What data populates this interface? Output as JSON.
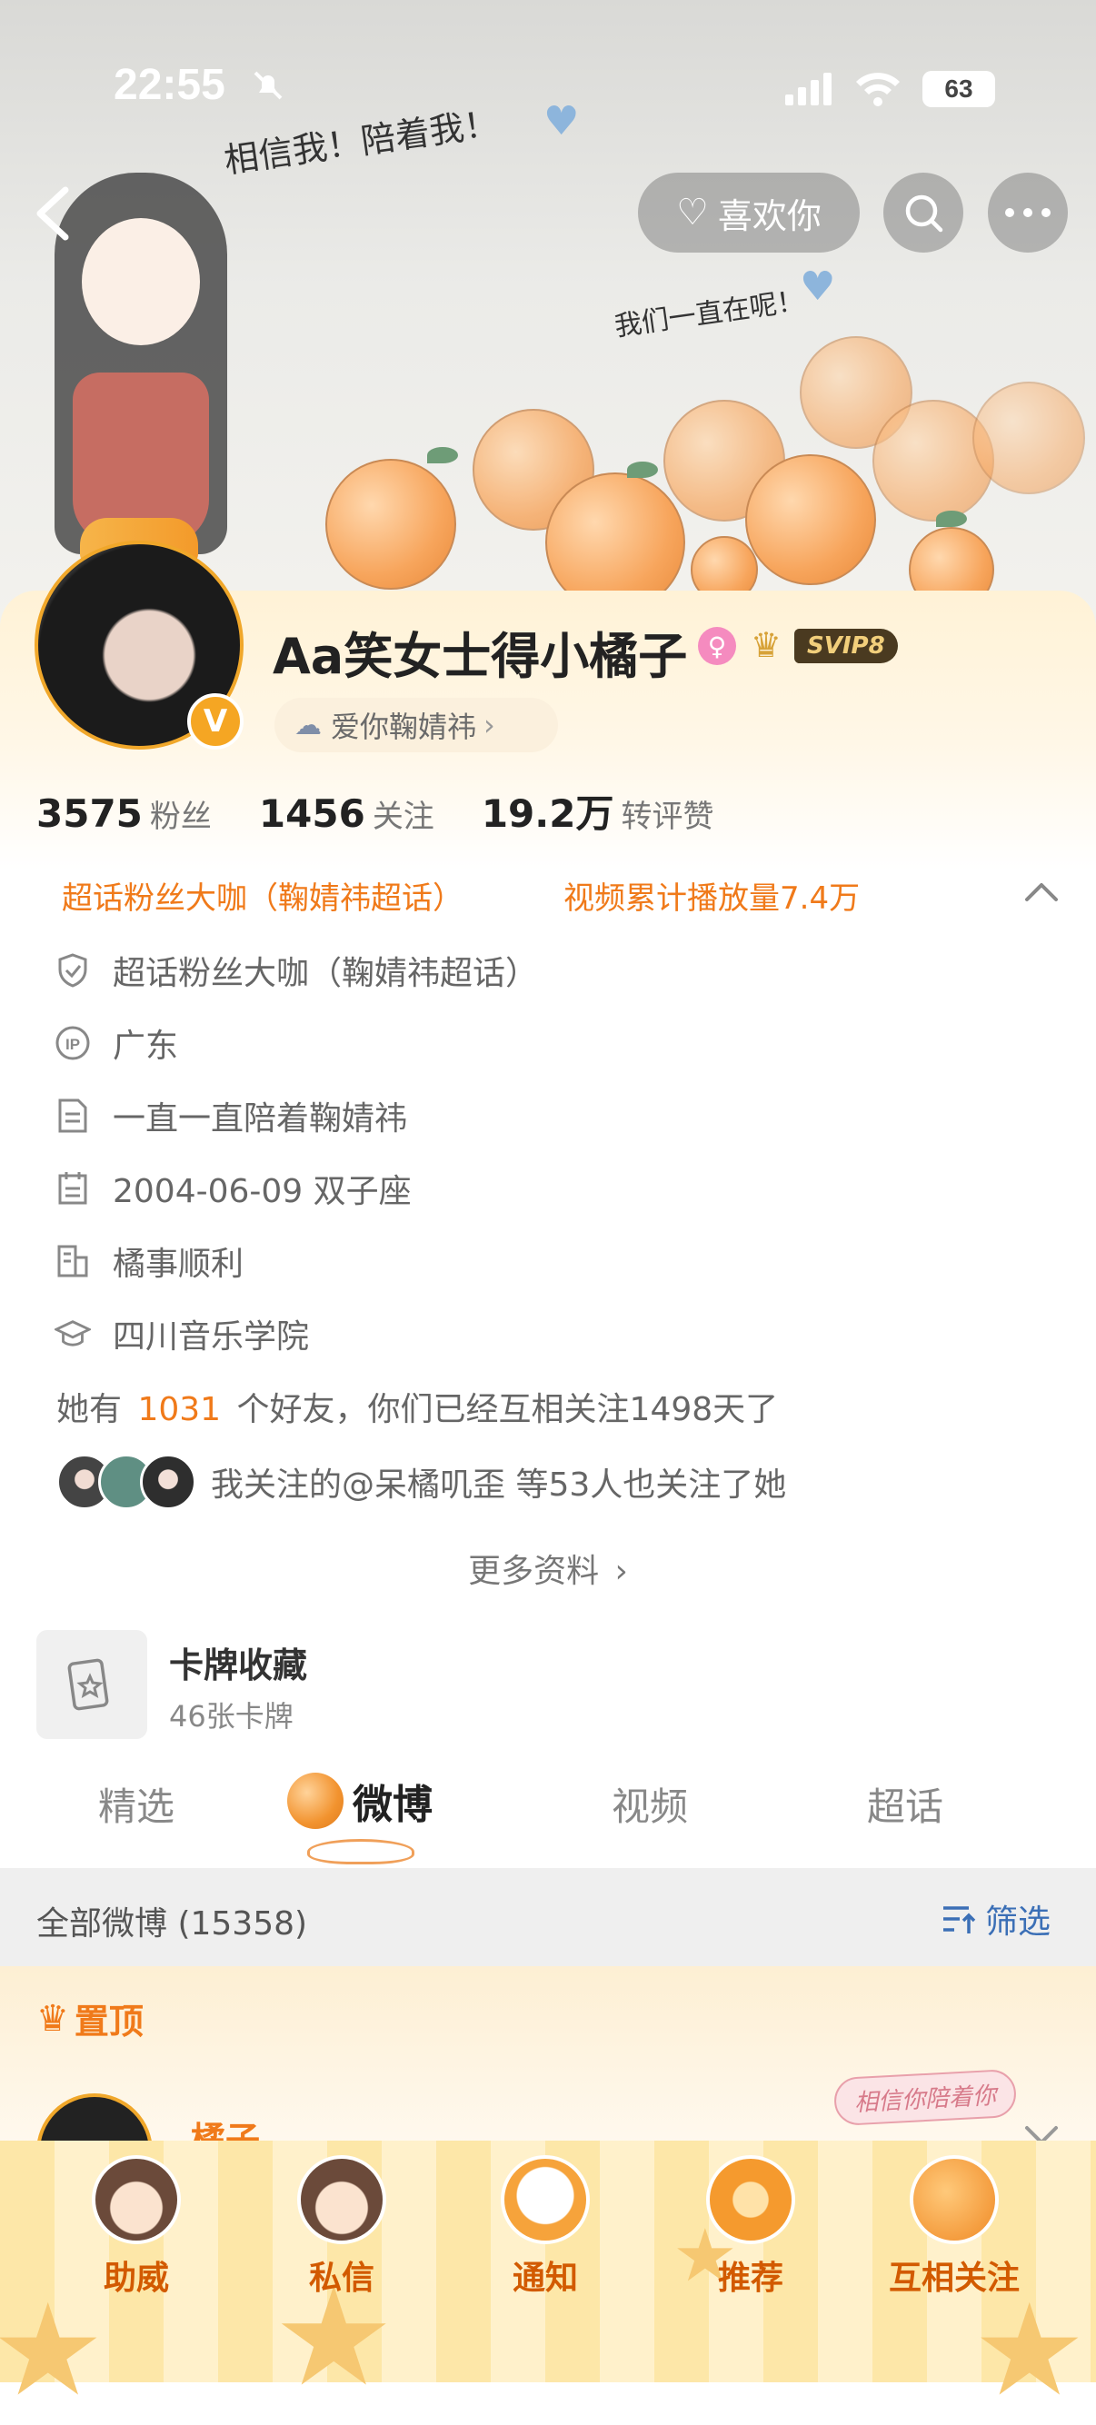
{
  "status_bar": {
    "time": "22:55",
    "battery": "63"
  },
  "header": {
    "like_label": "喜欢你",
    "banner_text_1": "相信我！陪着我！",
    "banner_text_2": "我们一直在呢！"
  },
  "profile": {
    "name": "Aa笑女士得小橘子",
    "vip_label": "SVIP8",
    "fan_group_label": "爱你鞠婧祎",
    "stats": {
      "fans_count": "3575",
      "fans_label": "粉丝",
      "following_count": "1456",
      "following_label": "关注",
      "interactions_count": "19.2万",
      "interactions_label": "转评赞"
    },
    "tags": {
      "tag1": "超话粉丝大咖（鞠婧祎超话）",
      "tag2": "视频累计播放量7.4万"
    },
    "details": {
      "super_topic": "超话粉丝大咖（鞠婧祎超话）",
      "ip_location": "广东",
      "bio": "一直一直陪着鞠婧祎",
      "birthday": "2004-06-09 双子座",
      "company": "橘事顺利",
      "school": "四川音乐学院"
    },
    "friends_line": {
      "prefix": "她有",
      "count": "1031",
      "suffix": "个好友，你们已经互相关注1498天了"
    },
    "mutual_follow_text": "我关注的@呆橘叽歪  等53人也关注了她",
    "more_info": "更多资料"
  },
  "card_collection": {
    "title": "卡牌收藏",
    "subtitle": "46张卡牌"
  },
  "tabs": [
    {
      "label": "精选"
    },
    {
      "label": "微博"
    },
    {
      "label": "视频"
    },
    {
      "label": "超话"
    }
  ],
  "feed": {
    "all_label": "全部微博 (15358)",
    "filter_label": "筛选",
    "pinned_label": "置顶",
    "post_author": "橘子",
    "sticker_text": "相信你陪着你"
  },
  "dock": [
    {
      "label": "助威"
    },
    {
      "label": "私信"
    },
    {
      "label": "通知"
    },
    {
      "label": "推荐"
    },
    {
      "label": "互相关注"
    }
  ],
  "colors": {
    "accent_orange": "#f07a1a",
    "tag_orange": "#f07a1a",
    "vip_gold": "#d7a238",
    "dock_text": "#d25a00"
  }
}
